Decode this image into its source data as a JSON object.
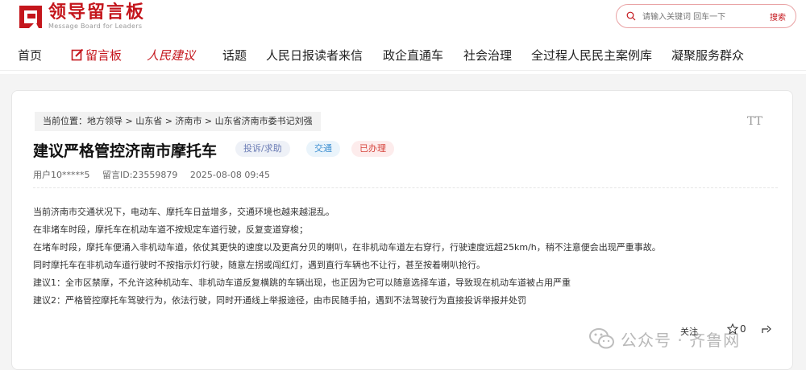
{
  "header": {
    "logo_cn": "领导留言板",
    "logo_en": "Message Board for Leaders",
    "search_placeholder": "请输入关键词 回车一下",
    "search_button": "搜索"
  },
  "nav": {
    "items": [
      "首页",
      "留言板",
      "人民建议",
      "话题",
      "人民日报读者来信",
      "政企直通车",
      "社会治理",
      "全过程人民民主案例库",
      "凝聚服务群众"
    ]
  },
  "post": {
    "breadcrumb": "当前位置：地方领导 > 山东省 > 济南市 > 山东省济南市委书记刘强",
    "font_toggle": "TT",
    "title": "建议严格管控济南市摩托车",
    "tags": [
      "投诉/求助",
      "交通",
      "已办理"
    ],
    "user": "用户10*****5",
    "message_id": "留言ID:23559879",
    "datetime": "2025-08-08 09:45",
    "paragraphs": [
      "当前济南市交通状况下，电动车、摩托车日益增多，交通环境也越来越混乱。",
      "在非堵车时段，摩托车在机动车道不按规定车道行驶，反复变道穿梭；",
      "在堵车时段，摩托车便涌入非机动车道，依仗其更快的速度以及更高分贝的喇叭，在非机动车道左右穿行，行驶速度远超25km/h，稍不注意便会出现严重事故。",
      "同时摩托车在非机动车道行驶时不按指示灯行驶，随意左拐或闯红灯，遇到直行车辆也不让行，甚至按着喇叭抢行。",
      "建议1：全市区禁摩，不允许这种机动车、非机动车道反复横跳的车辆出现，也正因为它可以随意选择车道，导致现在机动车道被占用严重",
      "建议2：严格管控摩托车驾驶行为，依法行驶，同时开通线上举报途径，由市民随手拍，遇到不法驾驶行为直接投诉举报并处罚"
    ]
  },
  "footer": {
    "follow": "关注",
    "star_count": "0",
    "watermark": "公众号 · 齐鲁网"
  },
  "colors": {
    "brand_red": "#c4161c",
    "band_gray": "#f4f4f4"
  }
}
